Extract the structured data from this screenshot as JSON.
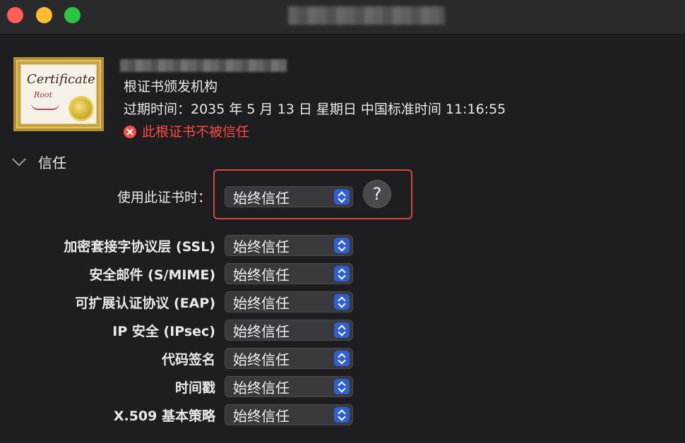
{
  "header": {
    "issuer_type": "根证书颁发机构",
    "expiry": "过期时间：2035 年 5 月 13 日 星期日 中国标准时间 11:16:55",
    "trust_warning": "此根证书不被信任"
  },
  "certificate_icon": {
    "word": "Certificate",
    "subword": "Root"
  },
  "trust_section": {
    "label": "信任",
    "primary": {
      "label": "使用此证书时：",
      "value": "始终信任",
      "help": "?"
    },
    "rows": [
      {
        "label": "加密套接字协议层 (SSL)",
        "value": "始终信任"
      },
      {
        "label": "安全邮件 (S/MIME)",
        "value": "始终信任"
      },
      {
        "label": "可扩展认证协议 (EAP)",
        "value": "始终信任"
      },
      {
        "label": "IP 安全 (IPsec)",
        "value": "始终信任"
      },
      {
        "label": "代码签名",
        "value": "始终信任"
      },
      {
        "label": "时间戳",
        "value": "始终信任"
      },
      {
        "label": "X.509 基本策略",
        "value": "始终信任"
      }
    ]
  },
  "colors": {
    "background": "#1e1d1f",
    "warning": "#ff4d45",
    "highlight_box": "#d84547",
    "stepper": "#2f5fd6"
  }
}
